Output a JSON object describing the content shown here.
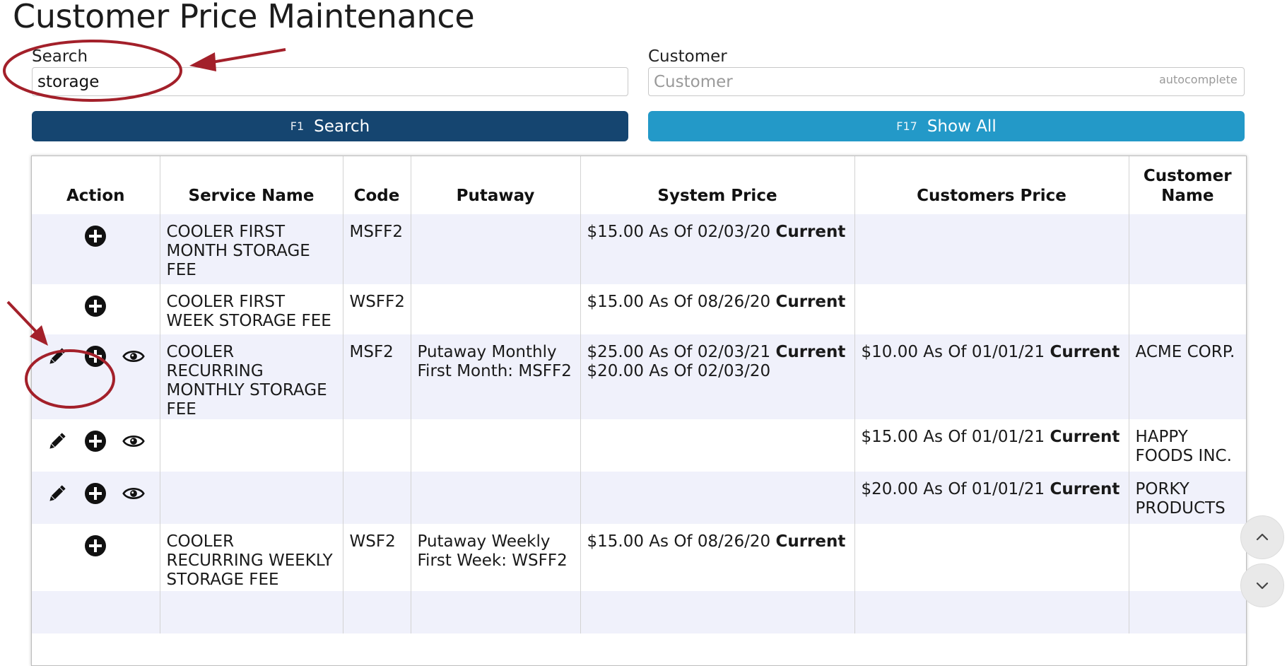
{
  "page": {
    "title": "Customer Price Maintenance"
  },
  "search": {
    "label": "Search",
    "value": "storage",
    "placeholder": ""
  },
  "customer": {
    "label": "Customer",
    "value": "",
    "placeholder": "Customer",
    "hint": "autocomplete"
  },
  "buttons": {
    "search": {
      "fkey": "F1",
      "label": "Search"
    },
    "show_all": {
      "fkey": "F17",
      "label": "Show All"
    }
  },
  "table": {
    "headers": [
      "Action",
      "Service Name",
      "Code",
      "Putaway",
      "System Price",
      "Customers Price",
      "Customer Name"
    ],
    "rows": [
      {
        "actions": [
          "add-icon"
        ],
        "service_name": "COOLER FIRST MONTH STORAGE FEE",
        "code": "MSFF2",
        "putaway": [],
        "system_price": [
          {
            "text": "$15.00 As Of 02/03/20",
            "status": "Current"
          }
        ],
        "customers_price": [],
        "customer_name": ""
      },
      {
        "actions": [
          "add-icon"
        ],
        "service_name": "COOLER FIRST WEEK STORAGE FEE",
        "code": "WSFF2",
        "putaway": [],
        "system_price": [
          {
            "text": "$15.00 As Of 08/26/20",
            "status": "Current"
          }
        ],
        "customers_price": [],
        "customer_name": ""
      },
      {
        "actions": [
          "pencil-icon",
          "add-icon",
          "eye-icon"
        ],
        "service_name": "COOLER RECURRING MONTHLY STORAGE FEE",
        "code": "MSF2",
        "putaway": [
          "Putaway Monthly",
          "First Month: MSFF2"
        ],
        "system_price": [
          {
            "text": "$25.00 As Of 02/03/21",
            "status": "Current"
          },
          {
            "text": "$20.00 As Of 02/03/20",
            "status": ""
          }
        ],
        "customers_price": [
          {
            "text": "$10.00 As Of 01/01/21",
            "status": "Current"
          }
        ],
        "customer_name": "ACME CORP."
      },
      {
        "actions": [
          "pencil-icon",
          "add-icon",
          "eye-icon"
        ],
        "service_name": "",
        "code": "",
        "putaway": [],
        "system_price": [],
        "customers_price": [
          {
            "text": "$15.00 As Of 01/01/21",
            "status": "Current"
          }
        ],
        "customer_name": "HAPPY FOODS INC."
      },
      {
        "actions": [
          "pencil-icon",
          "add-icon",
          "eye-icon"
        ],
        "service_name": "",
        "code": "",
        "putaway": [],
        "system_price": [],
        "customers_price": [
          {
            "text": "$20.00 As Of 01/01/21",
            "status": "Current"
          }
        ],
        "customer_name": "PORKY PRODUCTS"
      },
      {
        "actions": [
          "add-icon"
        ],
        "service_name": "COOLER RECURRING WEEKLY STORAGE FEE",
        "code": "WSF2",
        "putaway": [
          "Putaway Weekly",
          "First Week: WSFF2"
        ],
        "system_price": [
          {
            "text": "$15.00 As Of 08/26/20",
            "status": "Current"
          }
        ],
        "customers_price": [],
        "customer_name": ""
      },
      {
        "actions": [],
        "service_name": "",
        "code": "",
        "putaway": [],
        "system_price": [],
        "customers_price": [],
        "customer_name": ""
      }
    ]
  },
  "colors": {
    "search_button": "#154570",
    "show_all_button": "#2399c8",
    "row_alt": "#f0f1fb",
    "annotation": "#a3202a"
  },
  "scroll": {
    "up_icon": "chevron-up-icon",
    "down_icon": "chevron-down-icon"
  }
}
